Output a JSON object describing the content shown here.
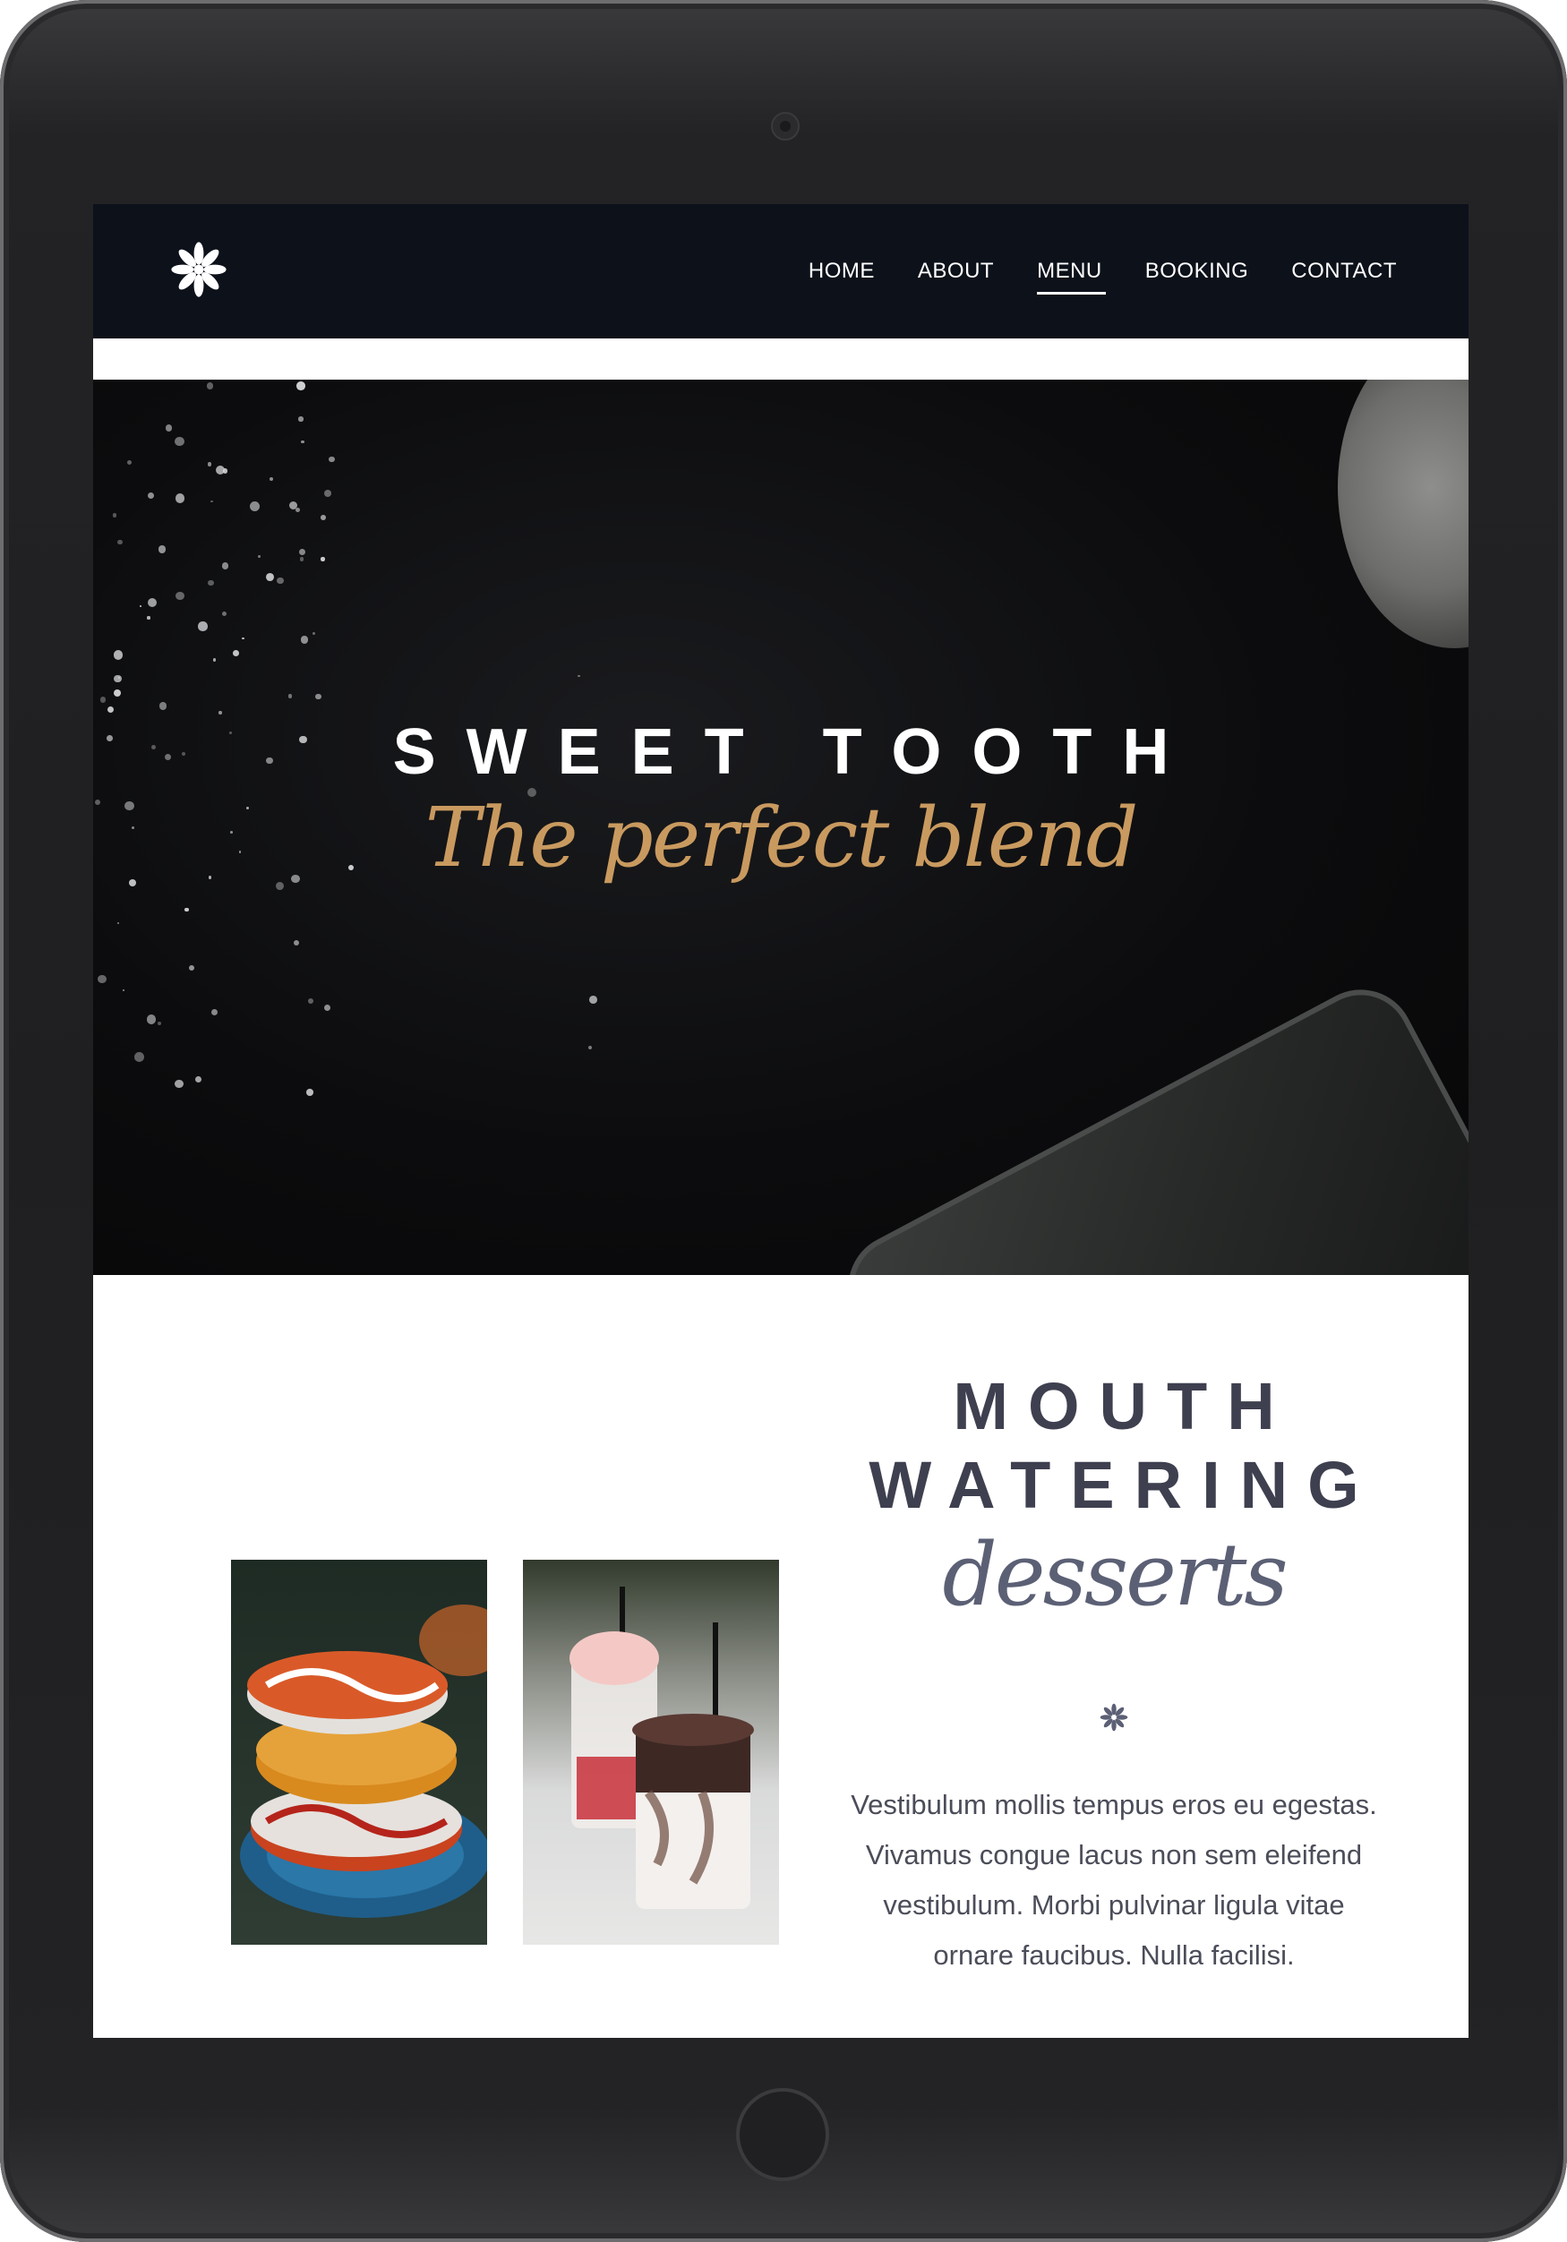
{
  "nav": {
    "items": [
      {
        "label": "HOME",
        "active": false
      },
      {
        "label": "ABOUT",
        "active": false
      },
      {
        "label": "MENU",
        "active": true
      },
      {
        "label": "BOOKING",
        "active": false
      },
      {
        "label": "CONTACT",
        "active": false
      }
    ]
  },
  "logo": {
    "icon": "asterisk-flower-icon",
    "color": "#ffffff"
  },
  "hero": {
    "title": "SWEET TOOTH",
    "subtitle": "The perfect blend",
    "subtitle_color": "#c99a5f"
  },
  "section": {
    "title_line1": "MOUTH",
    "title_line2": "WATERING",
    "title_script": "desserts",
    "divider_icon": "asterisk-icon",
    "body": "Vestibulum mollis tempus eros eu egestas. Vivamus congue lacus non sem eleifend vestibulum. Morbi pulvinar ligula vitae ornare faucibus. Nulla facilisi.",
    "photos": [
      "donuts-stack-photo",
      "iced-drinks-photo"
    ]
  },
  "colors": {
    "navbar_bg": "#0d111a",
    "heading": "#3e4050",
    "body_text": "#4b4d59"
  }
}
